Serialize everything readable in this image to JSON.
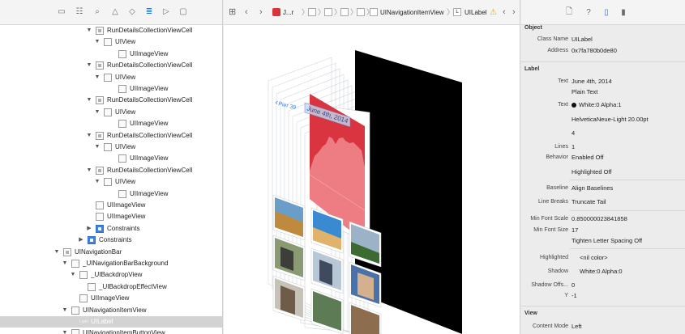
{
  "navigator": {
    "toolbar_icons": [
      "folder-icon",
      "hierarchy-icon",
      "search-icon",
      "warning-icon",
      "test-icon",
      "debug-icon",
      "breakpoint-icon",
      "report-icon"
    ],
    "rows": [
      {
        "label": "RunDetailsCollectionViewCell",
        "indent": 118,
        "expanded": true,
        "icon": "cell"
      },
      {
        "label": "UIView",
        "indent": 128,
        "expanded": true,
        "icon": "view"
      },
      {
        "label": "UIImageView",
        "indent": 146,
        "expanded": false,
        "icon": "view"
      },
      {
        "label": "RunDetailsCollectionViewCell",
        "indent": 118,
        "expanded": true,
        "icon": "cell"
      },
      {
        "label": "UIView",
        "indent": 128,
        "expanded": true,
        "icon": "view"
      },
      {
        "label": "UIImageView",
        "indent": 146,
        "expanded": false,
        "icon": "view"
      },
      {
        "label": "RunDetailsCollectionViewCell",
        "indent": 118,
        "expanded": true,
        "icon": "cell"
      },
      {
        "label": "UIView",
        "indent": 128,
        "expanded": true,
        "icon": "view"
      },
      {
        "label": "UIImageView",
        "indent": 146,
        "expanded": false,
        "icon": "view"
      },
      {
        "label": "RunDetailsCollectionViewCell",
        "indent": 118,
        "expanded": true,
        "icon": "cell"
      },
      {
        "label": "UIView",
        "indent": 128,
        "expanded": true,
        "icon": "view"
      },
      {
        "label": "UIImageView",
        "indent": 146,
        "expanded": false,
        "icon": "view"
      },
      {
        "label": "RunDetailsCollectionViewCell",
        "indent": 118,
        "expanded": true,
        "icon": "cell"
      },
      {
        "label": "UIView",
        "indent": 128,
        "expanded": true,
        "icon": "view"
      },
      {
        "label": "UIImageView",
        "indent": 146,
        "expanded": false,
        "icon": "view"
      },
      {
        "label": "UIImageView",
        "indent": 118,
        "expanded": false,
        "icon": "view"
      },
      {
        "label": "UIImageView",
        "indent": 118,
        "expanded": false,
        "icon": "view"
      },
      {
        "label": "Constraints",
        "indent": 118,
        "expanded": false,
        "collapsed": true,
        "icon": "blue"
      },
      {
        "label": "Constraints",
        "indent": 108,
        "expanded": false,
        "collapsed": true,
        "icon": "blue"
      },
      {
        "label": "UINavigationBar",
        "indent": 78,
        "expanded": true,
        "icon": "cell"
      },
      {
        "label": "_UINavigationBarBackground",
        "indent": 88,
        "expanded": true,
        "icon": "view"
      },
      {
        "label": "_UIBackdropView",
        "indent": 98,
        "expanded": true,
        "icon": "view"
      },
      {
        "label": "_UIBackdropEffectView",
        "indent": 108,
        "expanded": false,
        "icon": "view"
      },
      {
        "label": "UIImageView",
        "indent": 98,
        "expanded": false,
        "icon": "view"
      },
      {
        "label": "UINavigationItemView",
        "indent": 88,
        "expanded": true,
        "icon": "view"
      },
      {
        "label": "UILabel",
        "indent": 98,
        "expanded": false,
        "icon": "label",
        "selected": true,
        "tag": "Light"
      },
      {
        "label": "UINavigationItemButtonView",
        "indent": 88,
        "expanded": true,
        "icon": "view"
      }
    ]
  },
  "jumpbar": {
    "crumbs": [
      "J...r",
      "UINavigationItemView",
      "UILabel"
    ],
    "label_prefix": "L"
  },
  "scene": {
    "back_text": "Pier 39",
    "title_text": "June 4th, 2014",
    "chart_color": "#e0444e"
  },
  "inspector": {
    "toolbar_icons": [
      "file-icon",
      "help-icon",
      "object-icon",
      "size-icon"
    ],
    "object": {
      "header": "Object",
      "class_name_label": "Class Name",
      "class_name": "UILabel",
      "address_label": "Address",
      "address": "0x7fa780b0de80"
    },
    "label": {
      "header": "Label",
      "text_label": "Text",
      "text_value": "June 4th, 2014",
      "text_style": "Plain Text",
      "color_label": "Text",
      "color_value": "White:0 Alpha:1",
      "font_value": "HelveticaNeue-Light 20.00pt",
      "alignment_value": "4",
      "lines_label": "Lines",
      "lines_value": "1",
      "behavior_label": "Behavior",
      "behavior_value": "Enabled Off",
      "highlighted_value": "Highlighted Off",
      "baseline_label": "Baseline",
      "baseline_value": "Align Baselines",
      "line_breaks_label": "Line Breaks",
      "line_breaks_value": "Truncate Tail",
      "min_scale_label": "Min Font Scale",
      "min_scale_value": "0.850000023841858",
      "min_size_label": "Min Font Size",
      "min_size_value": "17",
      "tighten_value": "Tighten Letter Spacing Off",
      "highlighted_color_label": "Highlighted",
      "highlighted_color_value": "<nil color>",
      "shadow_label": "Shadow",
      "shadow_value": "White:0 Alpha:0",
      "shadow_offset_label": "Shadow Offs...",
      "shadow_offset_x": "0",
      "shadow_offset_y_label": "Y",
      "shadow_offset_y": "-1"
    },
    "view": {
      "header": "View",
      "content_mode_label": "Content Mode",
      "content_mode_value": "Left"
    }
  }
}
